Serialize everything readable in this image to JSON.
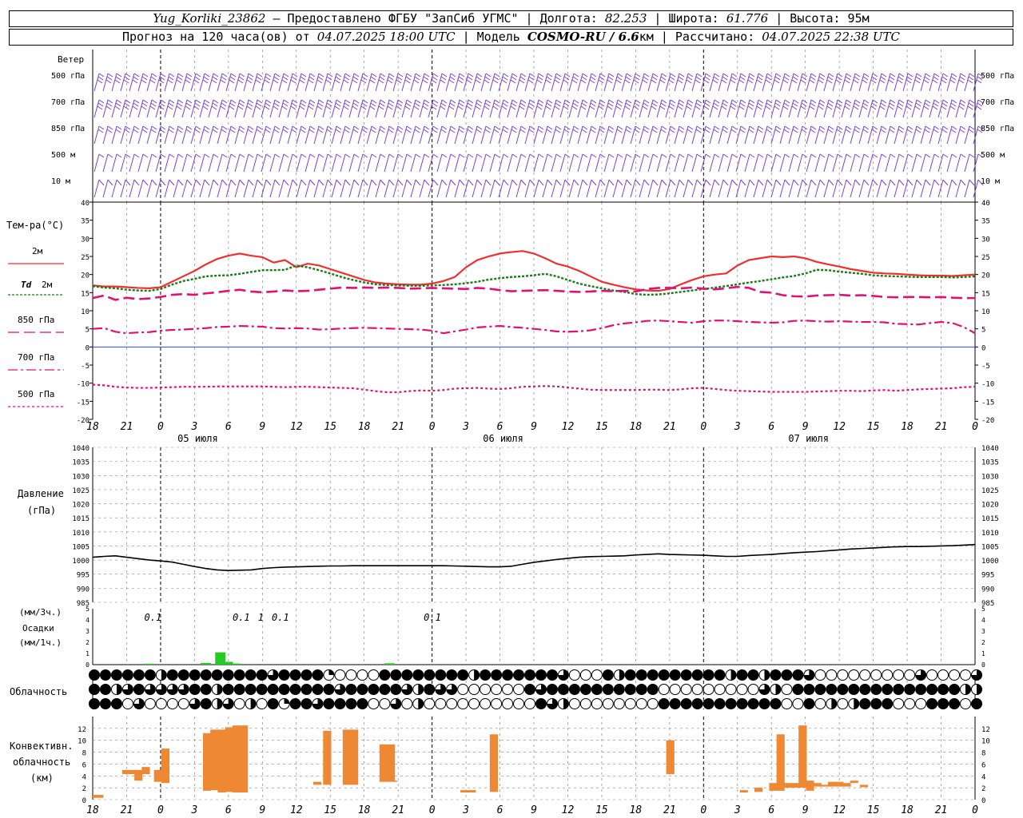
{
  "header": {
    "station": "Yug_Korliki_23862",
    "provider": "– Предоставлено ФГБУ \"ЗапСиб УГМС\" | Долгота: ",
    "lon": "82.253",
    "lat_label": " | Широта: ",
    "lat": "61.776",
    "alt_label": " | Высота: 95м",
    "forecast_label": "Прогноз на 120 часа(ов) от ",
    "forecast_from": "04.07.2025 18:00 UTC",
    "model_label": " | Модель ",
    "model": "COSMO-RU / 6.6",
    "model_res": "км | Рассчитано: ",
    "computed": "04.07.2025 22:38 UTC"
  },
  "labels": {
    "wind": "Ветер",
    "wind_levels": [
      "500 гПа",
      "700 гПа",
      "850 гПа",
      "500 м",
      "10  м"
    ],
    "temp": "Тем-ра(°С)",
    "t2m": "2м",
    "td": "Td",
    "td2": "2м",
    "t850": "850 гПа",
    "t700": "700 гПа",
    "t500": "500 гПа",
    "pressure": "Давление",
    "pressure_unit": "(гПа)",
    "precip_u1": "(мм/3ч.)",
    "precip": "Осадки",
    "precip_u2": "(мм/1ч.)",
    "cloud": "Облачность",
    "conv1": "Конвективн.",
    "conv2": "облачность",
    "conv3": "(км)",
    "dates": [
      "05 июля",
      "06 июля",
      "07 июля"
    ]
  },
  "colors": {
    "t2m": "#ee3030",
    "td": "#1a7a1a",
    "t850": "#dd1177",
    "t700": "#dd1177",
    "t500": "#dd1177",
    "wind": "#7a3fd6",
    "precip": "#22cc22",
    "conv": "#ee8833",
    "pressure": "#000000",
    "zero": "#3344ee"
  },
  "chart_data": [
    {
      "type": "line",
      "title": "Тем-ра(°С)",
      "x_hours": [
        0,
        3,
        6,
        9,
        12,
        15,
        18,
        21,
        24,
        27,
        30,
        33,
        36,
        39,
        42,
        45,
        48,
        51,
        54,
        57,
        60,
        63,
        66,
        69,
        72,
        75,
        78,
        81,
        84,
        87,
        90,
        93,
        96,
        99,
        102,
        105,
        108,
        111,
        114,
        117,
        120,
        123,
        126,
        129,
        132,
        135,
        138,
        141,
        144,
        147,
        150,
        153,
        156,
        159,
        162,
        165,
        168,
        171,
        174,
        177,
        180,
        183,
        186,
        189,
        192,
        195,
        198,
        201,
        204,
        207,
        210,
        213,
        216,
        219,
        222,
        225,
        228,
        231,
        234
      ],
      "x_tick_labels": [
        "18",
        "21",
        "0",
        "3",
        "6",
        "9",
        "12",
        "15",
        "18",
        "21",
        "0",
        "3",
        "6",
        "9",
        "12",
        "15",
        "18",
        "21",
        "0",
        "3",
        "6",
        "9",
        "12",
        "15",
        "18",
        "21",
        "0"
      ],
      "ylim": [
        -20,
        40
      ],
      "series": [
        {
          "name": "2м",
          "values": [
            17,
            16.7,
            16.7,
            16.5,
            16.3,
            16.2,
            16.5,
            18,
            19.5,
            21,
            22.8,
            24.3,
            25.2,
            25.8,
            25.2,
            24.8,
            23.3,
            24,
            22,
            23,
            22.5,
            21.5,
            20.5,
            19.5,
            18.5,
            17.8,
            17.5,
            17.3,
            17.2,
            17.2,
            17.5,
            18.2,
            19.3,
            22,
            24,
            25,
            25.8,
            26.2,
            26.5,
            25.8,
            24.5,
            23,
            22.2,
            21,
            19.5,
            18,
            17.2,
            16.5,
            15.9,
            15.6,
            15.5,
            16,
            17.3,
            18.5,
            19.5,
            20,
            20.3,
            22.5,
            24,
            24.5,
            25,
            24.8,
            25,
            24.5,
            23.5,
            22.8,
            22.2,
            21.5,
            21,
            20.5,
            20.3,
            20.2,
            20,
            19.8,
            19.7,
            19.7,
            19.6,
            19.8,
            20
          ]
        },
        {
          "name": "Td 2м",
          "values": [
            16.8,
            16.4,
            16.2,
            15.8,
            15.6,
            15.5,
            16,
            17.2,
            18.2,
            18.8,
            19.5,
            19.7,
            19.8,
            20.2,
            20.7,
            21.2,
            21.2,
            21.3,
            22.5,
            22,
            21.2,
            20.3,
            19.3,
            18.5,
            17.8,
            17.3,
            17.1,
            17,
            16.9,
            16.9,
            17,
            17.1,
            17.3,
            17.6,
            18,
            18.6,
            19,
            19.3,
            19.5,
            19.8,
            20.2,
            19.5,
            18.5,
            17.5,
            16.8,
            16.2,
            15.6,
            15.2,
            14.6,
            14.4,
            14.5,
            14.8,
            15.2,
            15.6,
            16,
            16.4,
            16.8,
            17.3,
            17.8,
            18.2,
            18.7,
            19.2,
            19.6,
            20.3,
            21.3,
            21.2,
            20.8,
            20.5,
            20.2,
            19.8,
            19.6,
            19.5,
            19.4,
            19.3,
            19.3,
            19.3,
            19.2,
            19.3,
            19.5
          ]
        },
        {
          "name": "850 гПа",
          "values": [
            13.5,
            14.2,
            13,
            13.6,
            13.2,
            13.4,
            13.8,
            14.4,
            14.6,
            14.4,
            14.8,
            15.1,
            15.5,
            15.8,
            15.3,
            15.1,
            15.3,
            15.6,
            15.4,
            15.5,
            15.8,
            16.1,
            16.4,
            16.3,
            16.4,
            16.3,
            16.4,
            16.3,
            16.1,
            16.2,
            16.3,
            16.2,
            16.1,
            16,
            16.3,
            16.1,
            15.7,
            15.4,
            15.5,
            15.6,
            15.7,
            15.5,
            15.3,
            15.2,
            15.3,
            15.5,
            15.4,
            15.5,
            15.3,
            16,
            16.3,
            16.3,
            16.2,
            16.4,
            16.1,
            15.9,
            16.2,
            16.6,
            16.3,
            15.2,
            15,
            14.3,
            14,
            13.9,
            14.2,
            14.3,
            14.4,
            14.2,
            14.3,
            14.1,
            13.8,
            13.7,
            13.8,
            13.8,
            13.7,
            13.8,
            13.6,
            13.5,
            13.5
          ]
        },
        {
          "name": "700 гПа",
          "values": [
            5,
            5.2,
            4.2,
            3.8,
            4,
            4.1,
            4.5,
            4.7,
            4.8,
            5,
            5.2,
            5.5,
            5.6,
            5.8,
            5.7,
            5.6,
            5.2,
            5.1,
            5.2,
            5.1,
            4.8,
            4.9,
            5.1,
            5.2,
            5.3,
            5.2,
            5.1,
            5,
            4.9,
            4.8,
            4.5,
            3.8,
            4.3,
            4.8,
            5.4,
            5.6,
            5.8,
            5.5,
            5.3,
            5,
            4.7,
            4.3,
            4.2,
            4.3,
            4.6,
            5.2,
            6,
            6.5,
            6.8,
            7.2,
            7.3,
            7.1,
            6.9,
            6.7,
            7.1,
            7.3,
            7.3,
            7.1,
            6.9,
            6.8,
            6.7,
            6.8,
            7.2,
            7.3,
            7.1,
            7,
            7.1,
            7,
            6.9,
            6.9,
            6.8,
            6.4,
            6.3,
            6.2,
            6.6,
            6.9,
            6.6,
            5.5,
            3.8
          ]
        },
        {
          "name": "500 гПа",
          "values": [
            -10.4,
            -10.6,
            -11,
            -11.2,
            -11.3,
            -11.3,
            -11.2,
            -11.1,
            -11,
            -11,
            -11,
            -10.9,
            -10.9,
            -10.9,
            -10.9,
            -10.9,
            -11,
            -11.1,
            -11,
            -11,
            -11.1,
            -11.2,
            -11.3,
            -11.4,
            -11.8,
            -12.2,
            -12.5,
            -12.5,
            -12.2,
            -12,
            -12.1,
            -11.9,
            -11.5,
            -11.4,
            -11.3,
            -11.5,
            -11.6,
            -11.4,
            -11,
            -10.9,
            -10.8,
            -10.9,
            -11.2,
            -11.5,
            -11.8,
            -11.9,
            -11.9,
            -11.9,
            -11.9,
            -11.8,
            -11.8,
            -11.9,
            -11.7,
            -11.4,
            -11.3,
            -11.6,
            -11.9,
            -12.1,
            -12.2,
            -12.3,
            -12.4,
            -12.4,
            -12.4,
            -12.4,
            -12.3,
            -12.2,
            -12.1,
            -12.1,
            -12.2,
            -12,
            -11.9,
            -12.1,
            -11.9,
            -11.7,
            -11.6,
            -11.5,
            -11.4,
            -11.1,
            -11
          ]
        }
      ]
    },
    {
      "type": "line",
      "title": "Давление",
      "ylabel": "(гПа)",
      "ylim": [
        985,
        1040
      ],
      "series": [
        {
          "name": "Давление",
          "values": [
            1001,
            1001.3,
            1001.5,
            1001,
            1000.5,
            1000,
            999.7,
            999.3,
            998.5,
            997.7,
            997,
            996.5,
            996.3,
            996.4,
            996.5,
            997,
            997.3,
            997.5,
            997.6,
            997.7,
            997.8,
            997.9,
            997.9,
            998,
            998,
            998,
            998,
            998,
            998,
            998,
            998,
            998,
            997.9,
            997.8,
            997.7,
            997.6,
            997.6,
            997.8,
            998.5,
            999.2,
            999.7,
            1000.2,
            1000.6,
            1001,
            1001.2,
            1001.3,
            1001.4,
            1001.5,
            1001.8,
            1002,
            1002.2,
            1002,
            1001.9,
            1001.8,
            1001.7,
            1001.5,
            1001.3,
            1001.3,
            1001.6,
            1001.8,
            1002,
            1002.3,
            1002.6,
            1002.8,
            1003,
            1003.3,
            1003.6,
            1003.9,
            1004.1,
            1004.3,
            1004.5,
            1004.7,
            1004.8,
            1004.8,
            1004.9,
            1005,
            1005.1,
            1005.3,
            1005.5
          ]
        }
      ]
    },
    {
      "type": "bar",
      "title": "Осадки",
      "ylim": [
        0,
        5
      ],
      "annotations_3h": [
        {
          "hour": 6,
          "text": "0.1"
        },
        {
          "hour": 42,
          "text": "0.1"
        },
        {
          "hour": 50,
          "text": "1"
        },
        {
          "hour": 58,
          "text": "0.1"
        },
        {
          "hour": 120,
          "text": "0.1"
        }
      ],
      "series": [
        {
          "name": "1h",
          "bars": [
            {
              "hour": 20,
              "value": 0.08
            },
            {
              "hour": 43,
              "value": 0.15
            },
            {
              "hour": 49,
              "value": 1.1
            },
            {
              "hour": 52,
              "value": 0.25
            },
            {
              "hour": 55,
              "value": 0.1
            },
            {
              "hour": 118,
              "value": 0.12
            }
          ]
        }
      ]
    },
    {
      "type": "bar",
      "title": "Конвективн. облачность",
      "ylim": [
        0,
        13
      ],
      "series": [
        {
          "name": "Конвективн. облачность",
          "bars": [
            {
              "hour": 0,
              "b": 0.3,
              "t": 0.8,
              "w": 4
            },
            {
              "hour": 12,
              "b": 4.3,
              "t": 5,
              "w": 5
            },
            {
              "hour": 17,
              "b": 3.2,
              "t": 5,
              "w": 3
            },
            {
              "hour": 20,
              "b": 4.3,
              "t": 5.5,
              "w": 3
            },
            {
              "hour": 25,
              "b": 3,
              "t": 5,
              "w": 3
            },
            {
              "hour": 28,
              "b": 2.8,
              "t": 8.6,
              "w": 3
            },
            {
              "hour": 45,
              "b": 1.5,
              "t": 11.2,
              "w": 3
            },
            {
              "hour": 48,
              "b": 1.6,
              "t": 11.8,
              "w": 3
            },
            {
              "hour": 51,
              "b": 1.2,
              "t": 11.8,
              "w": 3
            },
            {
              "hour": 54,
              "b": 1.3,
              "t": 12.2,
              "w": 3
            },
            {
              "hour": 57,
              "b": 1.2,
              "t": 12.5,
              "w": 3
            },
            {
              "hour": 60,
              "b": 1.2,
              "t": 12.5,
              "w": 3
            },
            {
              "hour": 90,
              "b": 2.5,
              "t": 3,
              "w": 3
            },
            {
              "hour": 94,
              "b": 2.5,
              "t": 11.6,
              "w": 3
            },
            {
              "hour": 102,
              "b": 2.5,
              "t": 11.8,
              "w": 6
            },
            {
              "hour": 117,
              "b": 3,
              "t": 9.3,
              "w": 6
            },
            {
              "hour": 123,
              "b": 3.2,
              "t": 3.2,
              "w": 1
            },
            {
              "hour": 150,
              "b": 1.2,
              "t": 1.6,
              "w": 6
            },
            {
              "hour": 162,
              "b": 1.3,
              "t": 11,
              "w": 3
            },
            {
              "hour": 234,
              "b": 4.3,
              "t": 10,
              "w": 3
            },
            {
              "hour": 264,
              "b": 1.2,
              "t": 1.6,
              "w": 3
            },
            {
              "hour": 270,
              "b": 1.3,
              "t": 2,
              "w": 3
            },
            {
              "hour": 276,
              "b": 1.5,
              "t": 2.8,
              "w": 3
            },
            {
              "hour": 279,
              "b": 1.5,
              "t": 11,
              "w": 3
            },
            {
              "hour": 282,
              "b": 2,
              "t": 2.8,
              "w": 6
            },
            {
              "hour": 288,
              "b": 2,
              "t": 12.5,
              "w": 3
            },
            {
              "hour": 291,
              "b": 1.5,
              "t": 3.2,
              "w": 3
            },
            {
              "hour": 294,
              "b": 2.2,
              "t": 2.8,
              "w": 3
            },
            {
              "hour": 297,
              "b": 2.2,
              "t": 2.5,
              "w": 3
            },
            {
              "hour": 300,
              "b": 2.2,
              "t": 3,
              "w": 6
            },
            {
              "hour": 306,
              "b": 2.2,
              "t": 2.8,
              "w": 3
            },
            {
              "hour": 309,
              "b": 2.8,
              "t": 3.2,
              "w": 3
            },
            {
              "hour": 313,
              "b": 2.1,
              "t": 2.5,
              "w": 3
            }
          ]
        }
      ]
    }
  ]
}
